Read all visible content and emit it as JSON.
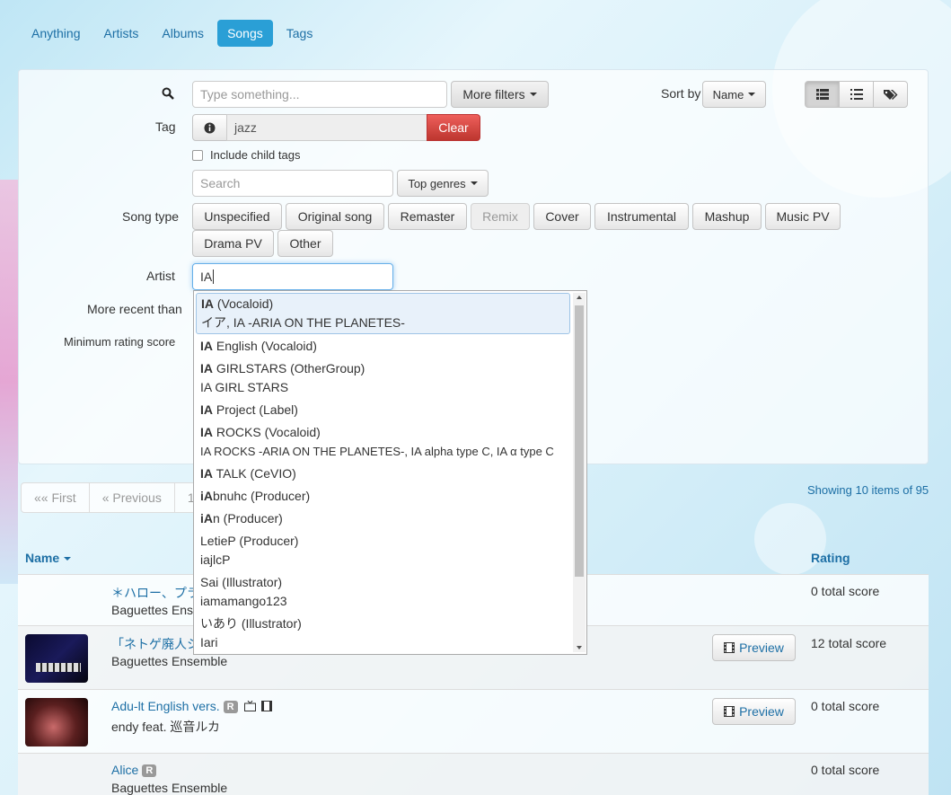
{
  "nav": {
    "tabs": [
      {
        "label": "Anything"
      },
      {
        "label": "Artists"
      },
      {
        "label": "Albums"
      },
      {
        "label": "Songs",
        "active": true
      },
      {
        "label": "Tags"
      }
    ]
  },
  "search": {
    "placeholder": "Type something...",
    "more_filters": "More filters",
    "sort_label": "Sort by",
    "sort_value": "Name"
  },
  "tag": {
    "label": "Tag",
    "value": "jazz",
    "clear": "Clear",
    "include_child": "Include child tags",
    "search_placeholder": "Search",
    "top_genres": "Top genres"
  },
  "song_type": {
    "label": "Song type",
    "options": [
      "Unspecified",
      "Original song",
      "Remaster",
      "Remix",
      "Cover",
      "Instrumental",
      "Mashup",
      "Music PV",
      "Drama PV",
      "Other"
    ]
  },
  "artist": {
    "label": "Artist",
    "value": "IA"
  },
  "filters": {
    "more_recent": "More recent than",
    "min_rating": "Minimum rating score"
  },
  "autocomplete": {
    "items": [
      {
        "bold": "IA",
        "rest": " (Vocaloid)",
        "sub": "イア, IA -ARIA ON THE PLANETES-"
      },
      {
        "bold": "IA",
        "rest": " English (Vocaloid)",
        "sub": ""
      },
      {
        "bold": "IA",
        "rest": " GIRLSTARS (OtherGroup)",
        "sub": "IA GIRL STARS"
      },
      {
        "bold": "IA",
        "rest": " Project (Label)",
        "sub": ""
      },
      {
        "bold": "IA",
        "rest": " ROCKS (Vocaloid)",
        "sub": "IA ROCKS -ARIA ON THE PLANETES-, IA alpha type C, IA α type C"
      },
      {
        "bold": "IA",
        "rest": " TALK (CeVIO)",
        "sub": ""
      },
      {
        "bold": "iA",
        "rest": "bnuhc (Producer)",
        "sub": ""
      },
      {
        "bold": "iA",
        "rest": "n (Producer)",
        "sub": ""
      },
      {
        "bold": "",
        "rest": "LetieP (Producer)",
        "sub": "iajlcP"
      },
      {
        "bold": "",
        "rest": "Sai (Illustrator)",
        "sub": "iamamango123"
      },
      {
        "bold": "",
        "rest": "いあり (Illustrator)",
        "sub": "Iari"
      }
    ]
  },
  "pager": {
    "first": "«« First",
    "prev": "« Previous",
    "page": "1",
    "showing": "Showing 10 items of 95"
  },
  "table": {
    "col_name": "Name",
    "col_rating": "Rating",
    "preview": "Preview",
    "rows": [
      {
        "title": "＊ハロー、プラ",
        "artist": "Baguettes Ensemble",
        "score": "0 total score"
      },
      {
        "title": "「ネトゲ廃人シ",
        "artist": "Baguettes Ensemble",
        "score": "12 total score"
      },
      {
        "title": "Adu-lt English vers.",
        "badge": "R",
        "artist": "endy feat. 巡音ルカ",
        "score": "0 total score"
      },
      {
        "title": "Alice",
        "badge": "R",
        "artist": "Baguettes Ensemble",
        "score": "0 total score"
      }
    ]
  },
  "colors": {
    "accent": "#2a9fd6",
    "link": "#1d6fa5",
    "danger": "#d9534f"
  }
}
